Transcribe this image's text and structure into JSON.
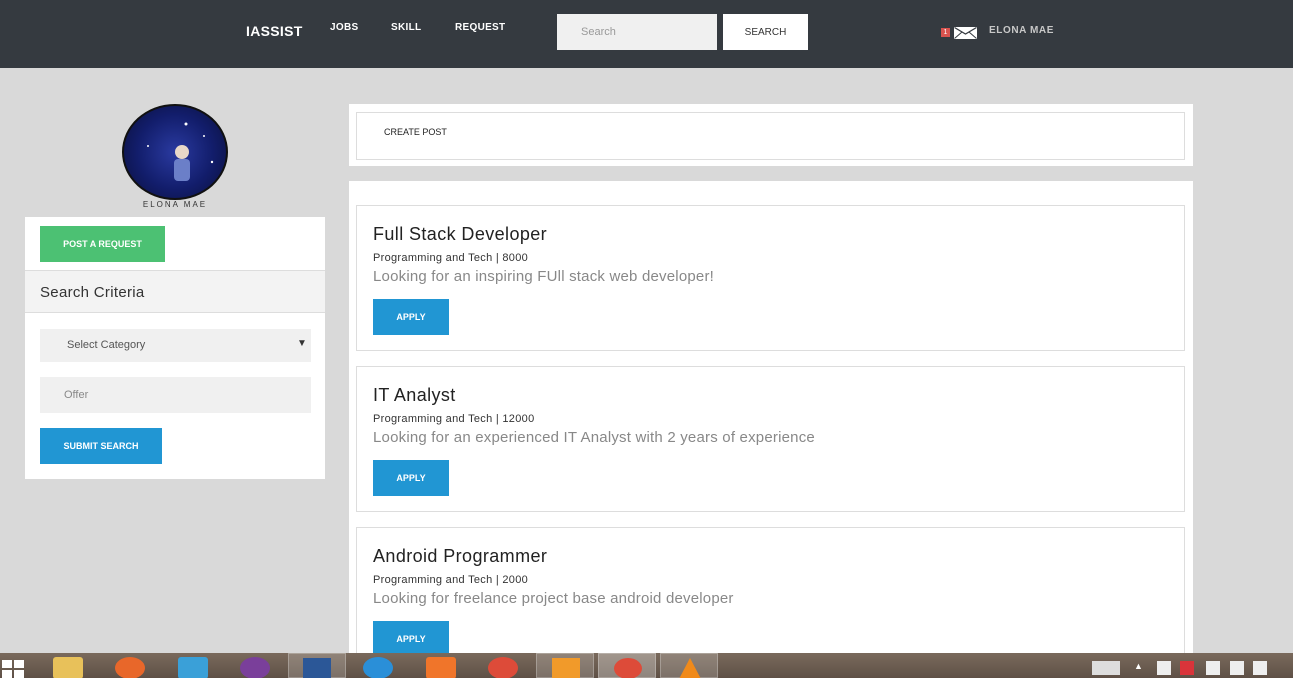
{
  "nav": {
    "brand": "IASSIST",
    "links": [
      "JOBS",
      "SKILL",
      "REQUEST"
    ],
    "search_placeholder": "Search",
    "search_button": "SEARCH",
    "notification_count": "1",
    "user_name": "ELONA MAE"
  },
  "sidebar": {
    "avatar_name": "ELONA MAE",
    "post_button": "POST A REQUEST",
    "criteria_title": "Search Criteria",
    "category_select": "Select Category",
    "offer_placeholder": "Offer",
    "submit_button": "SUBMIT SEARCH"
  },
  "main": {
    "create_post": "CREATE POST",
    "jobs": [
      {
        "title": "Full Stack Developer",
        "meta": "Programming and Tech | 8000",
        "description": "Looking for an inspiring FUll stack web developer!",
        "button": "APPLY"
      },
      {
        "title": "IT Analyst",
        "meta": "Programming and Tech | 12000",
        "description": "Looking for an experienced IT Analyst with 2 years of experience",
        "button": "APPLY"
      },
      {
        "title": "Android Programmer",
        "meta": "Programming and Tech | 2000",
        "description": "Looking for freelance project base android developer",
        "button": "APPLY"
      }
    ]
  },
  "taskbar": {
    "icons": [
      "windows-start",
      "file-explorer",
      "firefox",
      "app-store",
      "github-desktop",
      "word",
      "sync-app",
      "xampp",
      "chrome",
      "sublime-text",
      "chrome-active",
      "vlc"
    ]
  },
  "colors": {
    "nav_bg": "#353a40",
    "green": "#4cc173",
    "blue": "#2196d3",
    "page_bg": "#d9d9d9"
  }
}
